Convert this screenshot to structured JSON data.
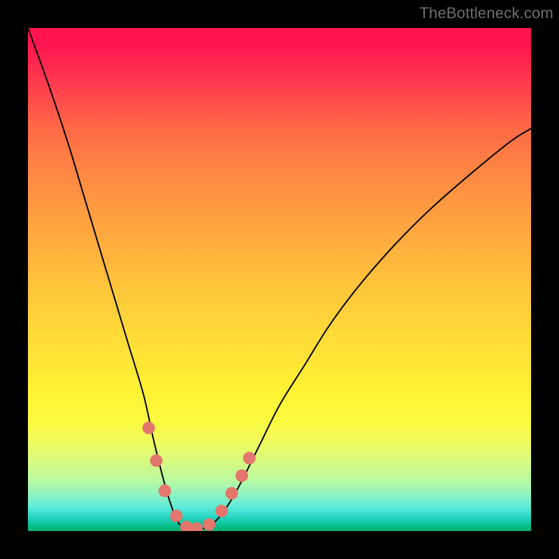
{
  "attribution": "TheBottleneck.com",
  "chart_data": {
    "type": "line",
    "title": "",
    "xlabel": "",
    "ylabel": "",
    "xlim": [
      0,
      100
    ],
    "ylim": [
      0,
      100
    ],
    "series": [
      {
        "name": "curve",
        "x": [
          0,
          4,
          8,
          11,
          14,
          17,
          20,
          23,
          25,
          27,
          28.5,
          30,
          32,
          34,
          36.5,
          39,
          42,
          46,
          50,
          55,
          60,
          66,
          73,
          80,
          88,
          96,
          100
        ],
        "values": [
          100,
          89,
          77,
          67,
          57,
          47,
          37,
          27,
          18,
          10,
          5,
          1.5,
          0.3,
          0.3,
          1.3,
          4,
          9,
          17,
          25,
          33,
          41,
          49,
          57,
          64,
          71,
          77.5,
          80
        ]
      }
    ],
    "markers": [
      {
        "x": 24.0,
        "y": 20.5
      },
      {
        "x": 25.5,
        "y": 14.0
      },
      {
        "x": 27.2,
        "y": 8.0
      },
      {
        "x": 29.5,
        "y": 3.0
      },
      {
        "x": 31.5,
        "y": 0.8
      },
      {
        "x": 33.5,
        "y": 0.5
      },
      {
        "x": 36.0,
        "y": 1.3
      },
      {
        "x": 38.5,
        "y": 4.0
      },
      {
        "x": 40.5,
        "y": 7.5
      },
      {
        "x": 42.5,
        "y": 11.0
      },
      {
        "x": 44.0,
        "y": 14.5
      }
    ],
    "marker_color": "#e5766d",
    "curve_color": "#000000",
    "background_gradient": {
      "stops": [
        {
          "pos": 0,
          "color": "#ff1450"
        },
        {
          "pos": 0.3,
          "color": "#ff8b43"
        },
        {
          "pos": 0.64,
          "color": "#ffe137"
        },
        {
          "pos": 0.86,
          "color": "#d8fb7e"
        },
        {
          "pos": 1.0,
          "color": "#00b070"
        }
      ]
    }
  }
}
